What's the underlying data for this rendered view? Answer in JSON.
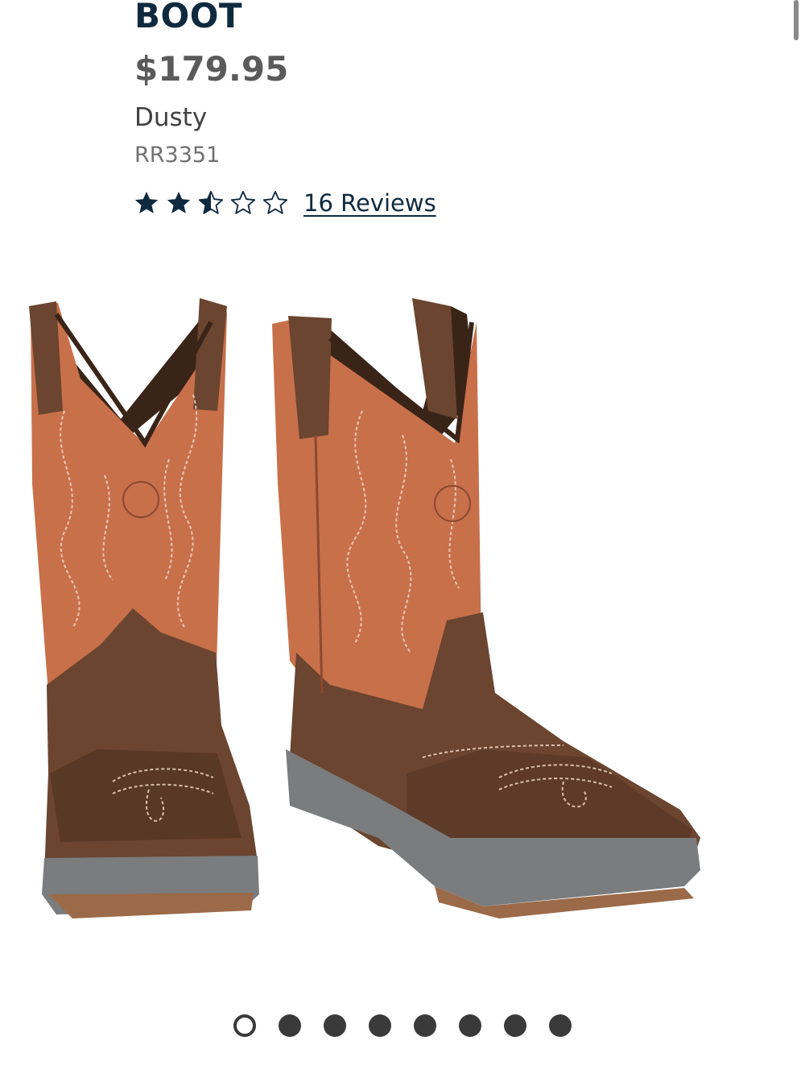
{
  "product": {
    "title": "BOOT",
    "price": "$179.95",
    "color": "Dusty",
    "sku": "RR3351"
  },
  "rating": {
    "value": 2.5,
    "max": 5,
    "reviews_label": "16 Reviews"
  },
  "icons": {
    "star_full": "star-full-icon",
    "star_half": "star-half-icon",
    "star_empty": "star-empty-icon"
  },
  "gallery": {
    "image": "brown western boots with orange shafts",
    "current_index": 1,
    "total_images": 8
  },
  "colors": {
    "title": "#0f2a3f",
    "price": "#5a5a5a",
    "star": "#0f2a3f",
    "dot": "#3a3a3a",
    "boot_shaft": "#c86f48",
    "boot_foot": "#6b4530",
    "boot_sole": "#7a7c7e"
  }
}
